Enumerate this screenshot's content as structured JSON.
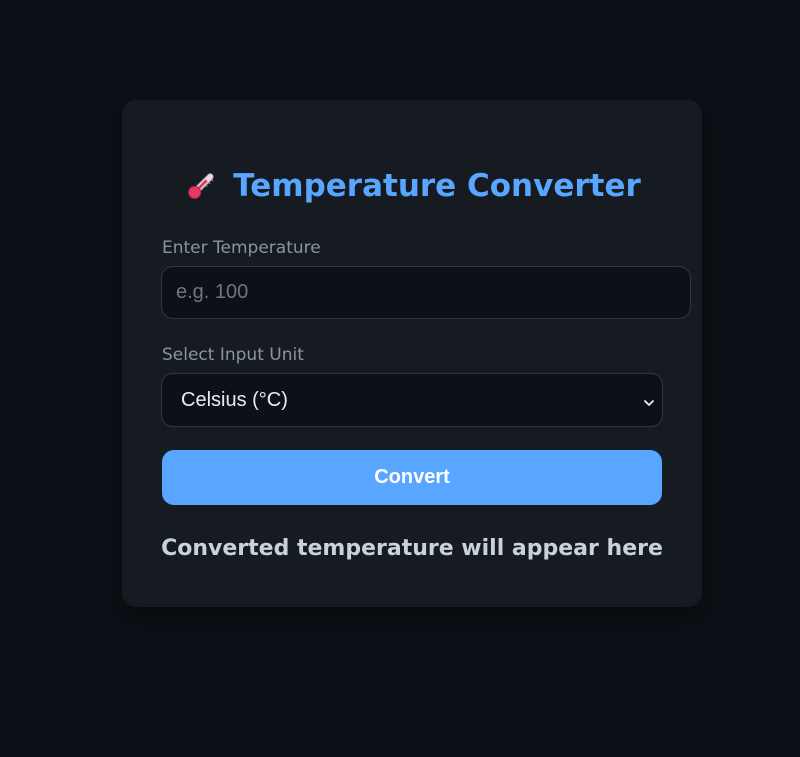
{
  "app": {
    "title": "Temperature Converter",
    "title_icon": "thermometer-icon"
  },
  "form": {
    "temperature_label": "Enter Temperature",
    "temperature_placeholder": "e.g. 100",
    "temperature_value": "",
    "unit_label": "Select Input Unit",
    "unit_selected": "Celsius (°C)",
    "convert_label": "Convert"
  },
  "result": {
    "text": "Converted temperature will appear here"
  },
  "colors": {
    "background": "#0d1117",
    "card": "#161b22",
    "accent": "#58a6ff",
    "label": "#8b949e"
  }
}
